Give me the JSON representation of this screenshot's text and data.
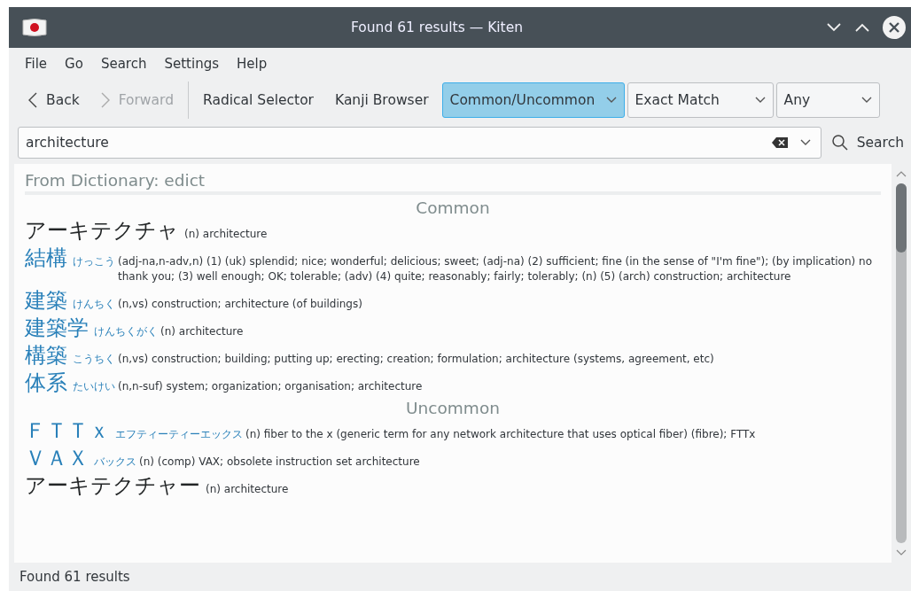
{
  "window": {
    "title": "Found 61 results — Kiten"
  },
  "menu": [
    "File",
    "Go",
    "Search",
    "Settings",
    "Help"
  ],
  "toolbar": {
    "back": {
      "label": "Back",
      "disabled": false
    },
    "forward": {
      "label": "Forward",
      "disabled": true
    },
    "buttons": [
      "Radical Selector",
      "Kanji Browser"
    ],
    "combos": [
      {
        "value": "Common/Uncommon",
        "highlighted": true
      },
      {
        "value": "Exact Match",
        "highlighted": false
      },
      {
        "value": "Any",
        "highlighted": false
      }
    ]
  },
  "search": {
    "value": "architecture",
    "button": "Search"
  },
  "results": {
    "heading": "From Dictionary: edict",
    "sections": [
      {
        "title": "Common",
        "entries": [
          {
            "word": "アーキテクチャ",
            "linked": false,
            "gloss": "(n) architecture"
          },
          {
            "word": "結構",
            "linked": true,
            "reading": "けっこう",
            "gloss": "(adj-na,n-adv,n) (1) (uk) splendid; nice; wonderful; delicious; sweet; (adj-na) (2) sufficient; fine (in the sense of \"I'm fine\"); (by implication) no thank you; (3) well enough; OK; tolerable; (adv) (4) quite; reasonably; fairly; tolerably; (n) (5) (arch) construction; architecture"
          },
          {
            "word": "建築",
            "linked": true,
            "reading": "けんちく",
            "gloss": "(n,vs) construction; architecture (of buildings)"
          },
          {
            "word": "建築学",
            "linked": true,
            "reading": "けんちくがく",
            "gloss": "(n) architecture"
          },
          {
            "word": "構築",
            "linked": true,
            "reading": "こうちく",
            "gloss": "(n,vs) construction; building; putting up; erecting; creation; formulation; architecture (systems, agreement, etc)"
          },
          {
            "word": "体系",
            "linked": true,
            "reading": "たいけい",
            "gloss": "(n,n-suf) system; organization; organisation; architecture"
          }
        ]
      },
      {
        "title": "Uncommon",
        "entries": [
          {
            "word": "ＦＴＴｘ",
            "linked": true,
            "reading": "エフティーティーエックス",
            "gloss": "(n) fiber to the x (generic term for any network architecture that uses optical fiber) (fibre); FTTx"
          },
          {
            "word": "ＶＡＸ",
            "linked": true,
            "reading": "バックス",
            "gloss": "(n) (comp) VAX; obsolete instruction set architecture"
          },
          {
            "word": "アーキテクチャー",
            "linked": false,
            "gloss": "(n) architecture"
          }
        ]
      }
    ]
  },
  "status_bar": "Found 61 results"
}
